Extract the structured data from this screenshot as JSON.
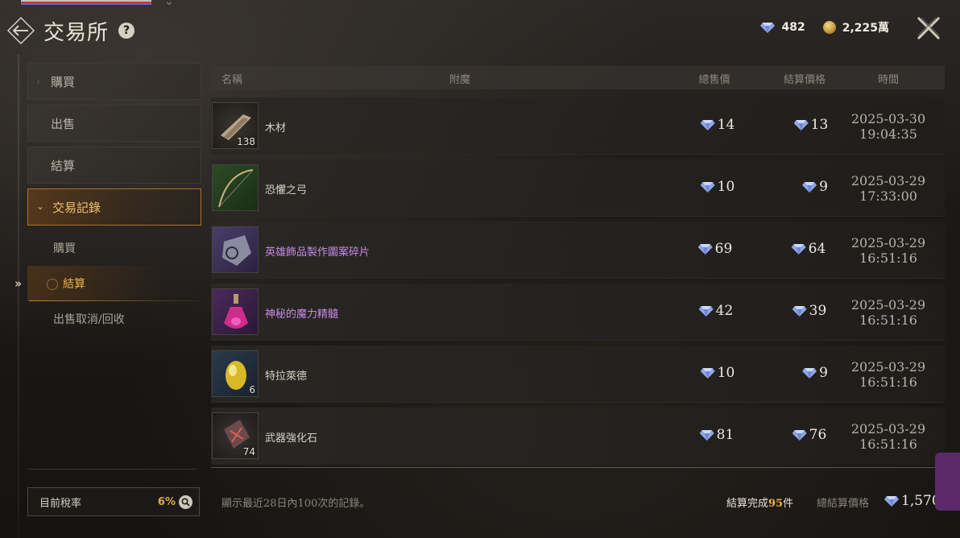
{
  "header": {
    "title": "交易所",
    "help_icon": "question-circle-icon",
    "back_icon": "back-arrow-icon",
    "close_icon": "close-x-icon"
  },
  "currency": {
    "gems": "482",
    "gold": "2,225萬"
  },
  "sidebar": {
    "items": [
      {
        "label": "購買",
        "icon": "chevron-right-icon"
      },
      {
        "label": "出售"
      },
      {
        "label": "結算"
      }
    ],
    "open_item": {
      "label": "交易記錄",
      "icon": "chevron-down-icon"
    },
    "sub_items": [
      {
        "label": "購買"
      },
      {
        "label": "結算",
        "active": true
      },
      {
        "label": "出售取消/回收"
      }
    ]
  },
  "tax": {
    "label": "目前稅率",
    "value": "6%"
  },
  "table": {
    "columns": [
      "名稱",
      "附魔",
      "總售價",
      "結算價格",
      "時間"
    ],
    "rows": [
      {
        "name": "木材",
        "quantity": "138",
        "total": "14",
        "settled": "13",
        "date": "2025-03-30",
        "time": "19:04:35",
        "icon": "wood-icon",
        "color": "normal"
      },
      {
        "name": "恐懼之弓",
        "quantity": "",
        "total": "10",
        "settled": "9",
        "date": "2025-03-29",
        "time": "17:33:00",
        "icon": "bow-icon",
        "color": "normal"
      },
      {
        "name": "英雄飾品製作圖案碎片",
        "quantity": "",
        "total": "69",
        "settled": "64",
        "date": "2025-03-29",
        "time": "16:51:16",
        "icon": "pattern-fragment-icon",
        "color": "purple"
      },
      {
        "name": "神秘的魔力精髓",
        "quantity": "",
        "total": "42",
        "settled": "39",
        "date": "2025-03-29",
        "time": "16:51:16",
        "icon": "potion-icon",
        "color": "purple"
      },
      {
        "name": "特拉萊德",
        "quantity": "6",
        "total": "10",
        "settled": "9",
        "date": "2025-03-29",
        "time": "16:51:16",
        "icon": "gem-egg-icon",
        "color": "normal"
      },
      {
        "name": "武器強化石",
        "quantity": "74",
        "total": "81",
        "settled": "76",
        "date": "2025-03-29",
        "time": "16:51:16",
        "icon": "enhance-stone-icon",
        "color": "normal"
      }
    ]
  },
  "footer": {
    "note": "顯示最近28日內100次的記錄。",
    "done_prefix": "結算完成",
    "done_count": "95",
    "done_suffix": "件",
    "total_label": "總結算價格",
    "total_value": "1,570"
  },
  "colors": {
    "accent_gold": "#f0b04a",
    "rare_purple": "#c88ae6",
    "gem_blue": "#9fb4f0"
  }
}
